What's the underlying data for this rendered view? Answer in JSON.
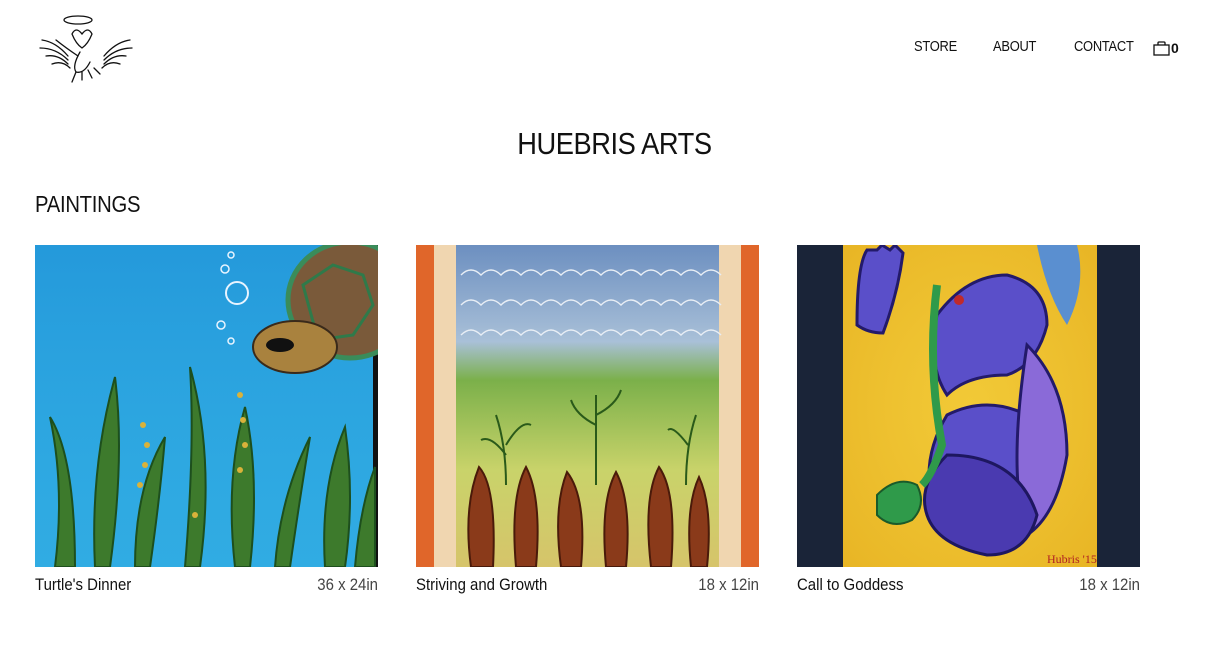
{
  "header": {
    "logo_icon": "angel-wings-logo-icon",
    "nav": [
      {
        "label": "STORE"
      },
      {
        "label": "ABOUT"
      },
      {
        "label": "CONTACT"
      }
    ],
    "cart": {
      "icon": "shopping-bag-icon",
      "count": "0"
    }
  },
  "main": {
    "title": "HUEBRIS ARTS",
    "section_title": "PAINTINGS",
    "paintings": [
      {
        "title": "Turtle's Dinner",
        "size": "36 x 24in"
      },
      {
        "title": "Striving and Growth",
        "size": "18 x 12in"
      },
      {
        "title": "Call to Goddess",
        "size": "18 x 12in"
      }
    ]
  },
  "colors": {
    "background": "#ffffff",
    "text": "#111111",
    "turtle_water": "#2fa7e0",
    "striving_frame": "#e0662a",
    "goddess_yellow": "#f0c22a",
    "goddess_purple": "#5a4fc9"
  }
}
